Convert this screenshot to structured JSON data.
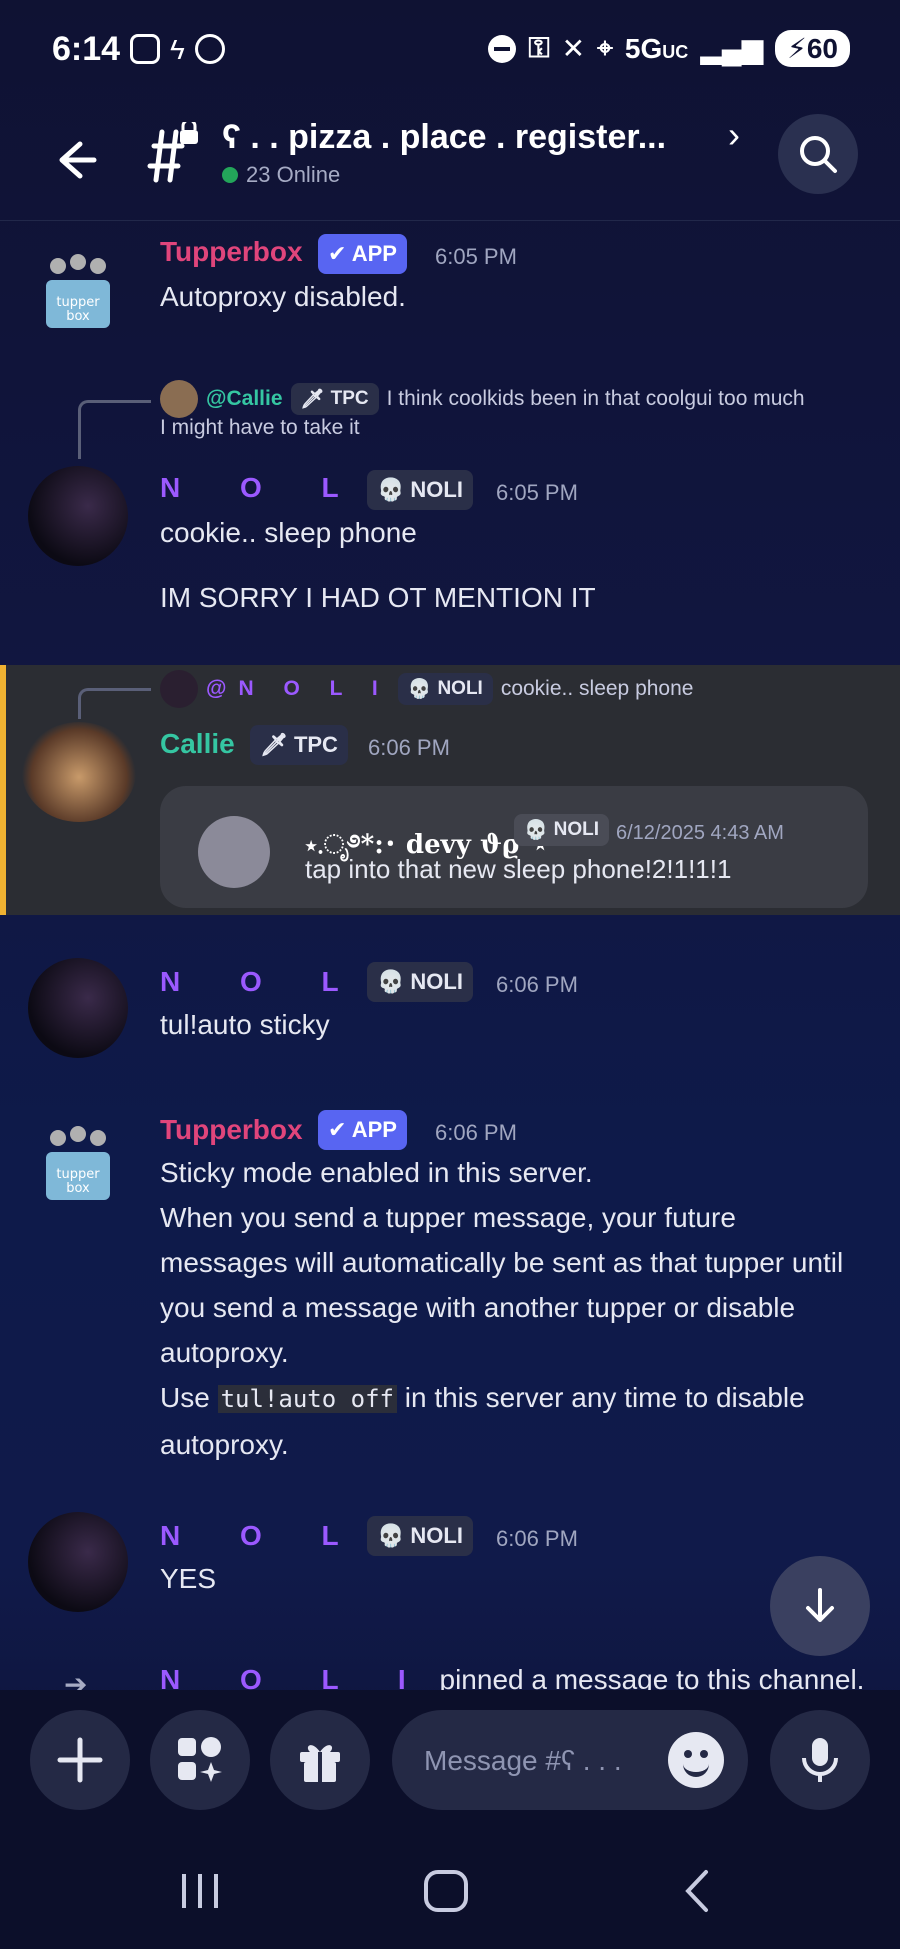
{
  "status_bar": {
    "time": "6:14",
    "network": "5G",
    "network_suffix": "UC",
    "battery": "60"
  },
  "header": {
    "channel_title": "ʕ . . pizza . place . register...",
    "online_count": "23 Online",
    "icons": [
      "back-arrow-icon",
      "locked-channel-icon",
      "chevron-right-icon",
      "search-icon"
    ]
  },
  "messages": [
    {
      "author": "Tupperbox",
      "tag": "✔ APP",
      "time": "6:05 PM",
      "text": "Autoproxy disabled."
    },
    {
      "reply": {
        "author": "@Callie",
        "tag": "TPC",
        "text": "I think coolkids been in that coolgui too much",
        "text2": "I might have to take it"
      },
      "author": "N O L I",
      "tag": "NOLI",
      "time": "6:05 PM",
      "text": "cookie.. sleep phone",
      "text2": "IM SORRY I HAD OT MENTION IT"
    },
    {
      "reply": {
        "author": "@N O L I",
        "tag": "NOLI",
        "text": "cookie.. sleep phone"
      },
      "author": "Callie",
      "tag": "TPC",
      "time": "6:06 PM",
      "embed": {
        "author": "⋆.ೃ࿔*:･ devy ϑϱ˚⋆",
        "tag": "NOLI",
        "time": "6/12/2025 4:43 AM",
        "text": "tap into that new sleep phone!2!1!1!1"
      }
    },
    {
      "author": "N O L I",
      "tag": "NOLI",
      "time": "6:06 PM",
      "text": "tul!auto sticky"
    },
    {
      "author": "Tupperbox",
      "tag": "✔ APP",
      "time": "6:06 PM",
      "line1": "Sticky mode enabled in this server.",
      "line2": "When you send a tupper message, your future messages will automatically be sent as that tupper until you send a message with another tupper or disable autoproxy.",
      "line3_pre": "Use ",
      "line3_code": "tul!auto off",
      "line3_post": " in this server any time to disable autoproxy."
    },
    {
      "author": "N O L I",
      "tag": "NOLI",
      "time": "6:06 PM",
      "text": "YES"
    },
    {
      "author": "N O L I",
      "text": "pinned a message to this channel."
    }
  ],
  "composer": {
    "placeholder": "Message #ʕ . . ...",
    "icons": [
      "add-icon",
      "apps-icon",
      "gift-icon",
      "emoji-icon",
      "microphone-icon"
    ]
  },
  "colors": {
    "background": "#0f1233",
    "tupperbox_name": "#e0457b",
    "noli_name": "#9b59ff",
    "callie_name": "#35c6a2",
    "app_badge": "#5865f2",
    "highlight_bar": "#f0b232"
  }
}
